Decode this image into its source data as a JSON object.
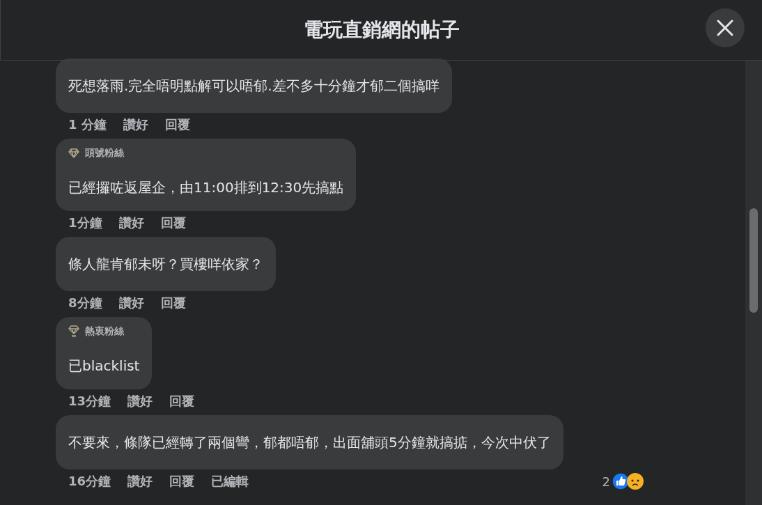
{
  "title": "電玩直銷網的帖子",
  "comments": [
    {
      "text": "死想落雨.完全唔明點解可以唔郁.差不多十分鐘才郁二個搞咩",
      "time": "1 分鐘",
      "like": "讚好",
      "reply": "回覆"
    },
    {
      "badge": {
        "kind": "diamond",
        "label": "頭號粉絲"
      },
      "text": "已經攞咗返屋企，由11:00排到12:30先搞點",
      "time": "1分鐘",
      "like": "讚好",
      "reply": "回覆"
    },
    {
      "text": "條人龍肯郁未呀？買樓咩依家？",
      "time": "8分鐘",
      "like": "讚好",
      "reply": "回覆"
    },
    {
      "badge": {
        "kind": "gem",
        "label": "熱衷粉絲"
      },
      "text": "已blacklist",
      "time": "13分鐘",
      "like": "讚好",
      "reply": "回覆"
    },
    {
      "text": "不要來，條隊已經轉了兩個彎，郁都唔郁，出面舖頭5分鐘就搞掂，今次中伏了",
      "time": "16分鐘",
      "like": "讚好",
      "reply": "回覆",
      "edited": "已編輯",
      "reactions": {
        "count": "2",
        "icons": [
          {
            "kind": "like"
          },
          {
            "kind": "sad"
          }
        ]
      }
    }
  ]
}
